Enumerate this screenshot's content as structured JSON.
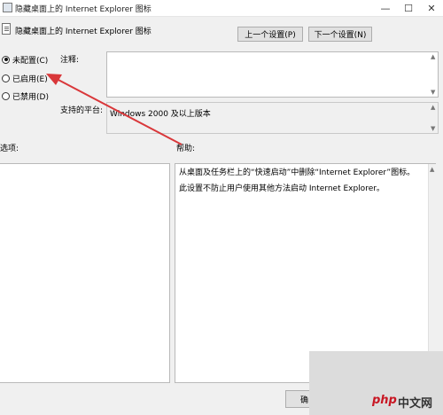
{
  "window": {
    "title": "隐藏桌面上的 Internet Explorer 图标",
    "minimize_glyph": "—",
    "maximize_glyph": "☐",
    "close_glyph": "✕"
  },
  "header": {
    "policy_title": "隐藏桌面上的 Internet Explorer 图标",
    "prev_button": "上一个设置(P)",
    "next_button": "下一个设置(N)"
  },
  "state_options": [
    {
      "label": "未配置(C)",
      "checked": true
    },
    {
      "label": "已启用(E)",
      "checked": false
    },
    {
      "label": "已禁用(D)",
      "checked": false
    }
  ],
  "comment": {
    "label": "注释:",
    "value": ""
  },
  "supported": {
    "label": "支持的平台:",
    "value": "Windows 2000 及以上版本"
  },
  "options": {
    "label": "选项:"
  },
  "help": {
    "label": "帮助:",
    "line1": "从桌面及任务栏上的“快速启动”中删除“Internet Explorer”图标。",
    "line2": "此设置不防止用户使用其他方法启动 Internet Explorer。"
  },
  "footer": {
    "ok_button_partial": "确"
  },
  "watermark": {
    "brand_php": "php",
    "brand_cn": "中文网"
  },
  "annotation": {
    "arrow_color": "#d9373a"
  }
}
